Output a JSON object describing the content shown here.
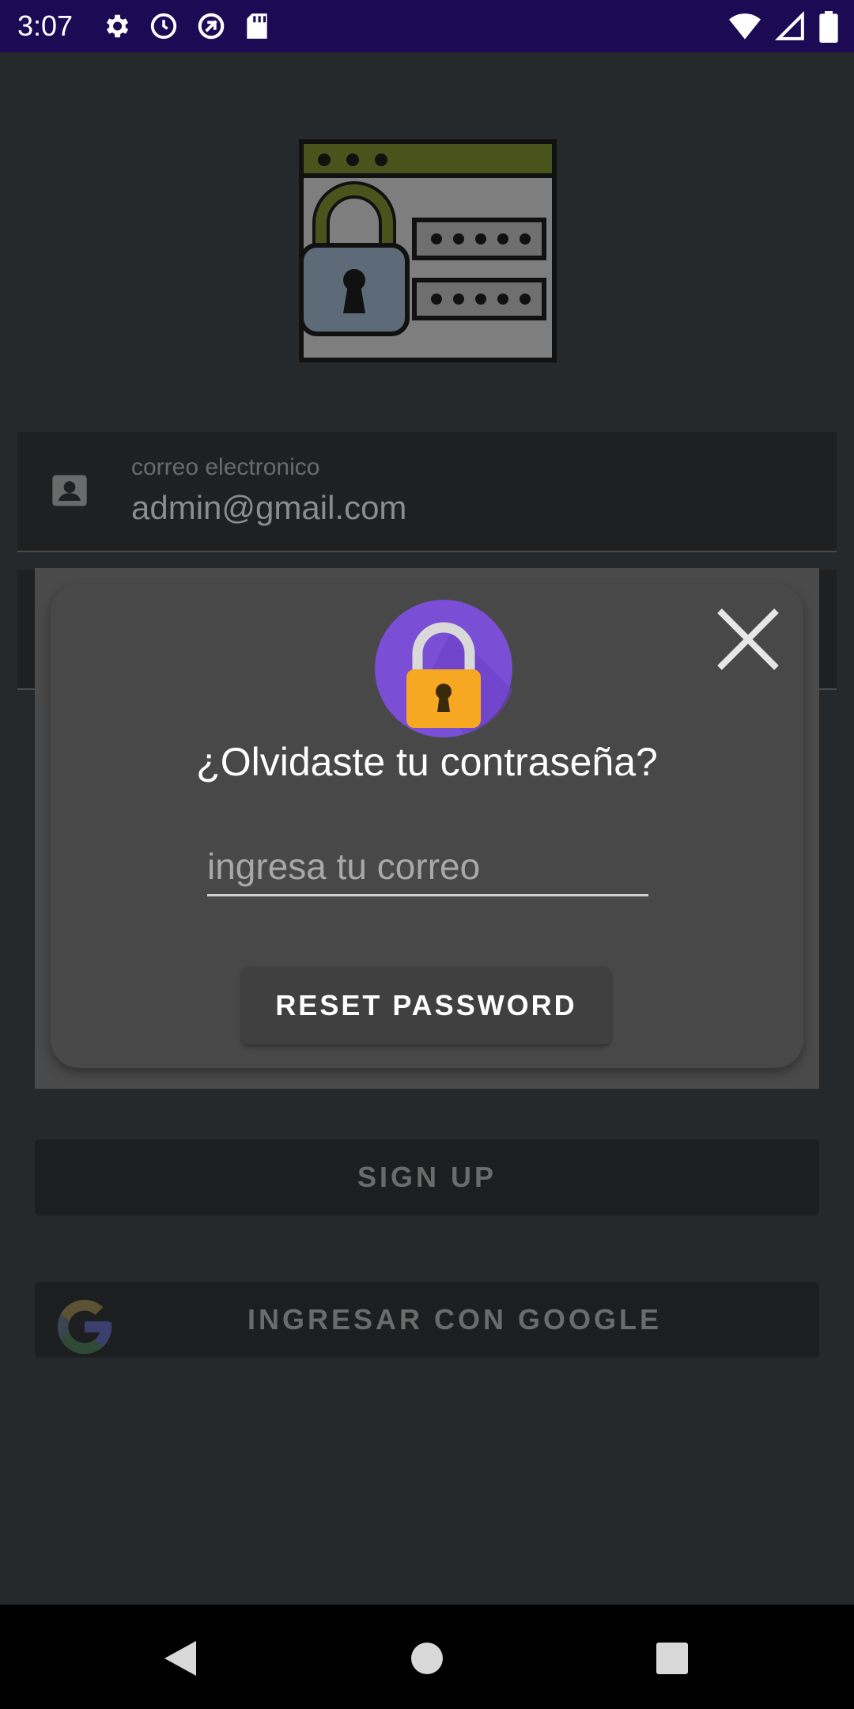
{
  "status_bar": {
    "time": "3:07",
    "left_icons": [
      "gear-icon",
      "clock-icon",
      "data-saver-icon",
      "sd-card-icon"
    ],
    "right_icons": [
      "wifi-icon",
      "signal-icon",
      "battery-icon"
    ]
  },
  "login": {
    "email_label": "correo electronico",
    "email_value": "admin@gmail.com",
    "signup_label": "SIGN UP",
    "google_label": "INGRESAR CON GOOGLE"
  },
  "dialog": {
    "title": "¿Olvidaste tu contraseña?",
    "email_placeholder": "ingresa tu correo",
    "reset_label": "RESET PASSWORD"
  },
  "colors": {
    "status_bar": "#1d0a55",
    "lock_badge": "#7a4fd6",
    "lock_body": "#f7a823"
  }
}
